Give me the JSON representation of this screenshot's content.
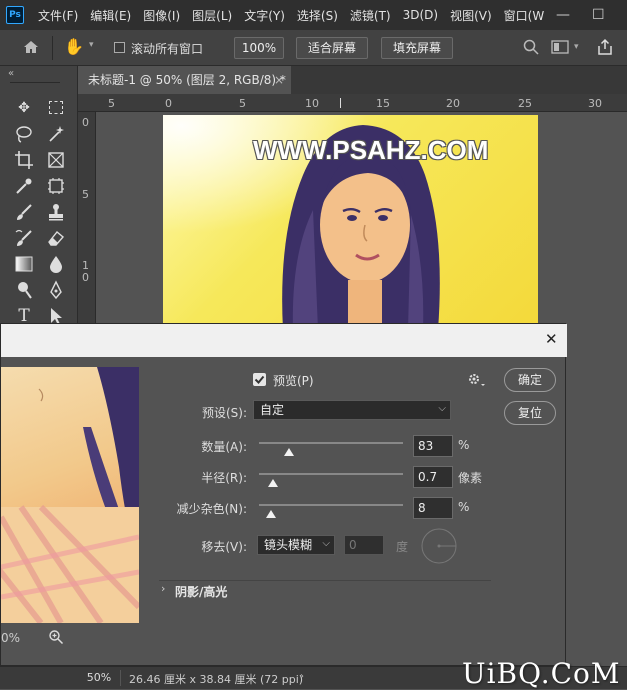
{
  "menubar": {
    "logo": "Ps",
    "items": [
      "文件(F)",
      "编辑(E)",
      "图像(I)",
      "图层(L)",
      "文字(Y)",
      "选择(S)",
      "滤镜(T)",
      "3D(D)",
      "视图(V)",
      "窗口(W"
    ],
    "minimize": "—",
    "maximize": "☐"
  },
  "options": {
    "scroll_all_label": "滚动所有窗口",
    "zoom_value": "100%",
    "fit_screen": "适合屏幕",
    "fill_screen": "填充屏幕"
  },
  "document": {
    "tab_title": "未标题-1 @ 50% (图层 2, RGB/8) *",
    "tab_close": "×"
  },
  "ruler": {
    "h_ticks": [
      "5",
      "0",
      "5",
      "10",
      "15",
      "20",
      "25",
      "30"
    ],
    "v_ticks": [
      "0",
      "5",
      "1",
      "0"
    ]
  },
  "canvas": {
    "watermark": "WWW.PSAHZ.COM"
  },
  "dialog": {
    "close": "✕",
    "preview_label": "预览(P)",
    "preview_checked": true,
    "ok": "确定",
    "reset": "复位",
    "preset_label": "预设(S):",
    "preset_value": "自定",
    "amount_label": "数量(A):",
    "amount_value": "83",
    "amount_unit": "%",
    "amount_level": 0.21,
    "radius_label": "半径(R):",
    "radius_value": "0.7",
    "radius_unit": "像素",
    "radius_level": 0.1,
    "noise_label": "减少杂色(N):",
    "noise_value": "8",
    "noise_unit": "%",
    "noise_level": 0.08,
    "remove_label": "移去(V):",
    "remove_value": "镜头模糊",
    "angle_value": "0",
    "angle_unit": "度",
    "shadow_section": "阴影/高光",
    "zoom_level": "0%"
  },
  "status": {
    "zoom": "50%",
    "doc_size": "26.46 厘米 x 38.84 厘米 (72 ppi)"
  },
  "site_watermark": "UiBQ.CoM"
}
